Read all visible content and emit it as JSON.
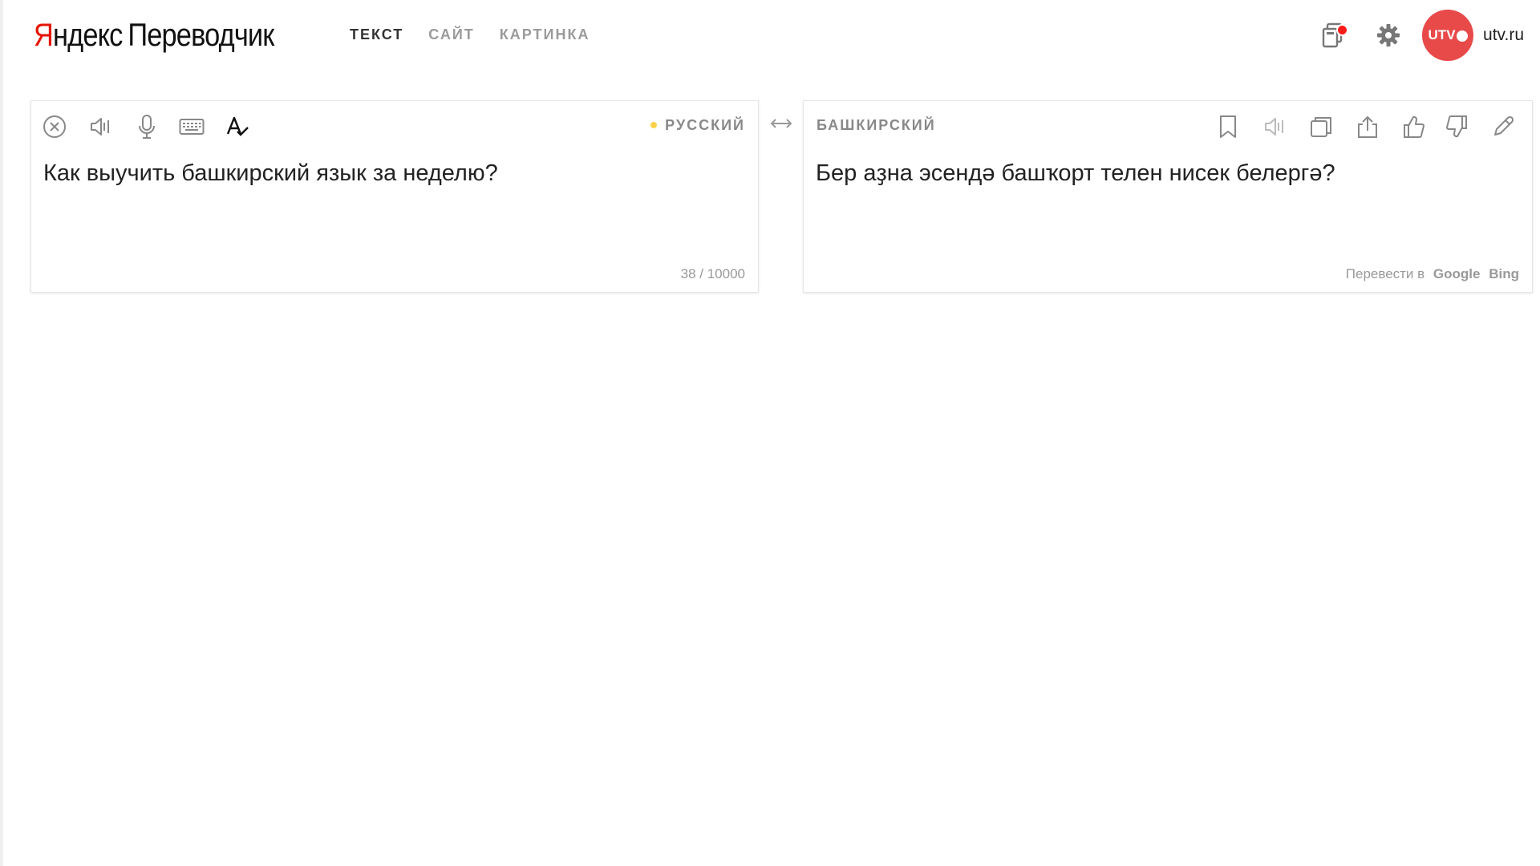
{
  "header": {
    "logo_brand_first": "Я",
    "logo_brand_rest": "ндекс",
    "logo_service": "Переводчик",
    "tabs": [
      {
        "label": "ТЕКСТ",
        "active": true
      },
      {
        "label": "САЙТ",
        "active": false
      },
      {
        "label": "КАРТИНКА",
        "active": false
      }
    ],
    "icons": {
      "collections": "collections-icon",
      "settings": "gear-icon"
    },
    "avatar_text": "UTV",
    "username": "utv.ru"
  },
  "source": {
    "language": "РУССКИЙ",
    "text": "Как выучить башкирский язык за неделю?",
    "counter": "38 / 10000",
    "tools": [
      "clear-icon",
      "speaker-icon",
      "microphone-icon",
      "keyboard-icon",
      "spellcheck-icon"
    ]
  },
  "swap_icon": "swap-arrows-icon",
  "target": {
    "language": "БАШКИРСКИЙ",
    "text": "Бер аҙна эсендә башҡорт телен нисек белергә?",
    "alt_label": "Перевести в",
    "alt_engines": [
      "Google",
      "Bing"
    ],
    "tools": [
      "bookmark-icon",
      "speaker-icon",
      "copy-icon",
      "share-icon",
      "thumbs-up-icon",
      "thumbs-down-icon",
      "edit-icon"
    ]
  },
  "colors": {
    "brand_red": "#e61400",
    "avatar_red": "#e84a4a",
    "notification_dot": "#ff1a1a",
    "lang_dot": "#fcd24a",
    "muted_text": "#9a9a9a"
  }
}
